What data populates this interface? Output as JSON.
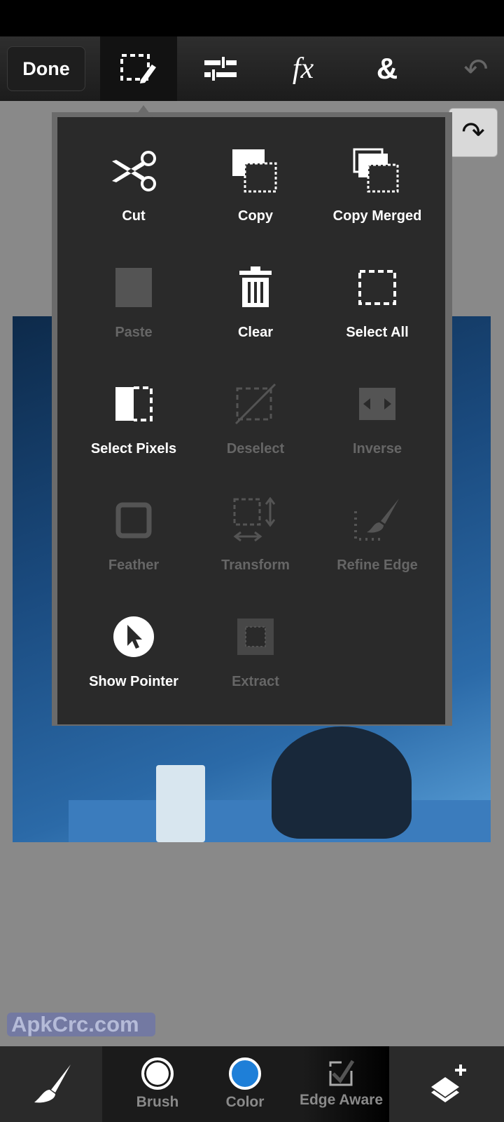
{
  "toolbar": {
    "done_label": "Done",
    "tools": [
      "selection-icon",
      "adjustments-icon",
      "fx-icon",
      "ampersand-icon",
      "undo-icon"
    ],
    "fx_glyph": "fx",
    "amp_glyph": "&"
  },
  "popup": {
    "items": [
      {
        "label": "Cut",
        "enabled": true,
        "icon": "scissors-icon"
      },
      {
        "label": "Copy",
        "enabled": true,
        "icon": "copy-icon"
      },
      {
        "label": "Copy Merged",
        "enabled": true,
        "icon": "copy-merged-icon"
      },
      {
        "label": "Paste",
        "enabled": false,
        "icon": "paste-icon"
      },
      {
        "label": "Clear",
        "enabled": true,
        "icon": "trash-icon"
      },
      {
        "label": "Select All",
        "enabled": true,
        "icon": "select-all-icon"
      },
      {
        "label": "Select Pixels",
        "enabled": true,
        "icon": "select-pixels-icon"
      },
      {
        "label": "Deselect",
        "enabled": false,
        "icon": "deselect-icon"
      },
      {
        "label": "Inverse",
        "enabled": false,
        "icon": "inverse-icon"
      },
      {
        "label": "Feather",
        "enabled": false,
        "icon": "feather-icon"
      },
      {
        "label": "Transform",
        "enabled": false,
        "icon": "transform-icon"
      },
      {
        "label": "Refine Edge",
        "enabled": false,
        "icon": "refine-edge-icon"
      },
      {
        "label": "Show Pointer",
        "enabled": true,
        "icon": "pointer-icon"
      },
      {
        "label": "Extract",
        "enabled": false,
        "icon": "extract-icon"
      }
    ]
  },
  "watermark": "ApkCrc.com",
  "bottombar": {
    "brush_label": "Brush",
    "color_label": "Color",
    "edge_label": "Edge Aware",
    "color": "#1e7fd8"
  }
}
